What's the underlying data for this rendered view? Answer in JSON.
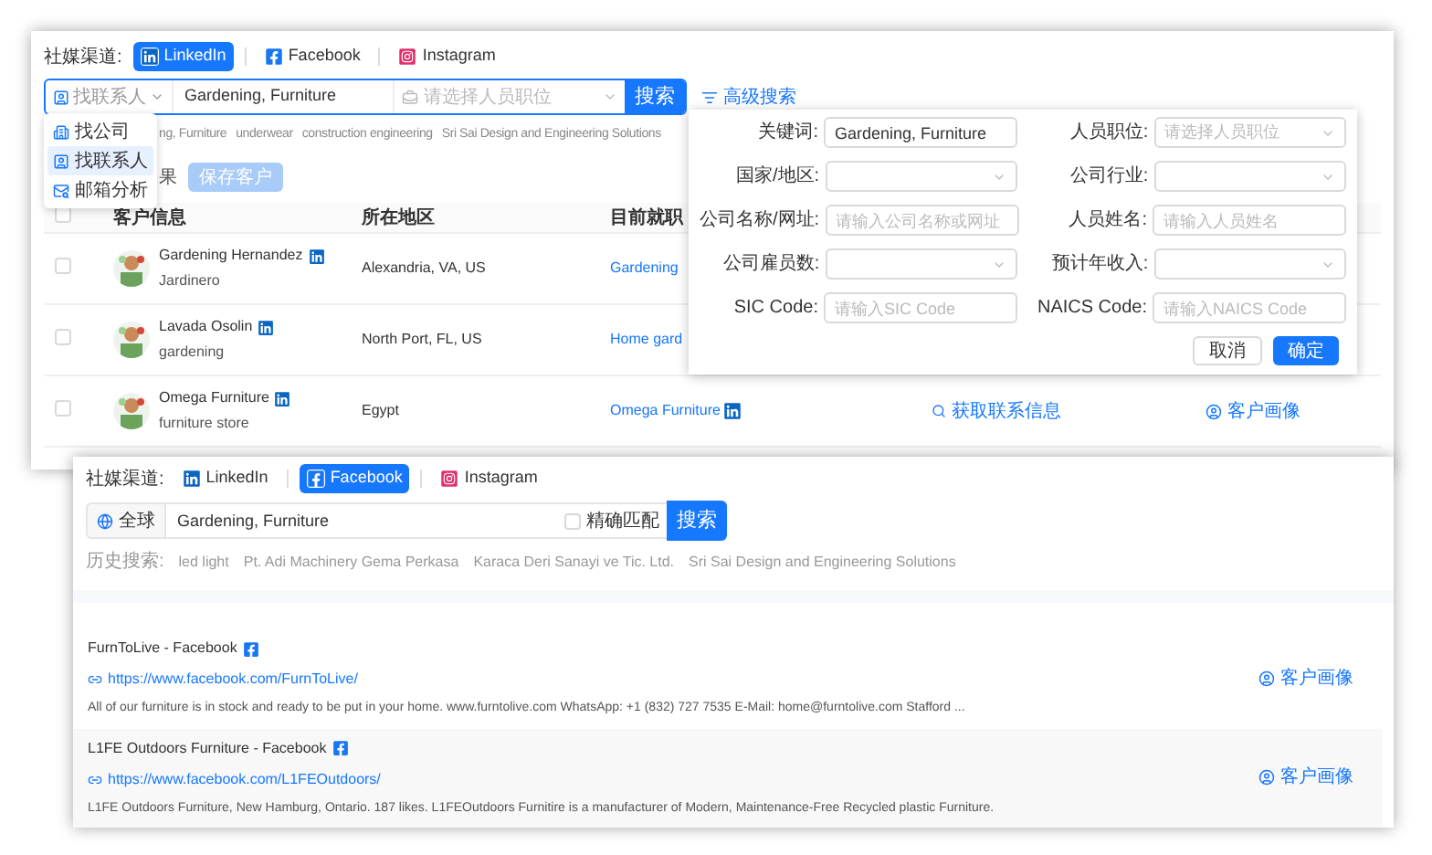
{
  "back_window": {
    "channel_label": "社媒渠道:",
    "channels": [
      {
        "name": "LinkedIn",
        "kind": "linkedin",
        "selected": true
      },
      {
        "name": "Facebook",
        "kind": "facebook",
        "selected": false
      },
      {
        "name": "Instagram",
        "kind": "instagram",
        "selected": false
      }
    ],
    "search": {
      "mode": "找联系人",
      "value": "Gardening, Furniture",
      "position_placeholder": "请选择人员职位",
      "button": "搜索"
    },
    "advanced_search": "高级搜索",
    "mode_menu": [
      {
        "label": "找公司",
        "kind": "company",
        "selected": false
      },
      {
        "label": "找联系人",
        "kind": "contact",
        "selected": true
      },
      {
        "label": "邮箱分析",
        "kind": "email",
        "selected": false
      }
    ],
    "history": [
      "ng, Furniture",
      "underwear",
      "construction engineering",
      "Sri Sai Design and Engineering Solutions"
    ],
    "result_label": "果",
    "save_button": {
      "label": "保存客户",
      "disabled": true
    },
    "table": {
      "checked": false,
      "columns": [
        "客户信息",
        "所在地区",
        "目前就职"
      ],
      "rows": [
        {
          "checked": false,
          "name": "Gardening Hernandez",
          "title": "Jardinero",
          "location": "Alexandria, VA, US",
          "company": "Gardening",
          "kind": "plain"
        },
        {
          "checked": false,
          "name": "Lavada Osolin",
          "title": "gardening",
          "location": "North Port, FL, US",
          "company": "Home gard",
          "kind": "plain"
        },
        {
          "checked": false,
          "name": "Omega Furniture",
          "title": "furniture store",
          "location": "Egypt",
          "company": "Omega Furniture",
          "kind": "badged",
          "contact_action": "获取联系信息",
          "profile_action": "客户画像"
        }
      ]
    }
  },
  "advanced_popover": {
    "fields": [
      {
        "label": "关键词:",
        "kind": "input",
        "value": "Gardening, Furniture"
      },
      {
        "label": "人员职位:",
        "kind": "select",
        "placeholder": "请选择人员职位"
      },
      {
        "label": "国家/地区:",
        "kind": "select"
      },
      {
        "label": "公司行业:",
        "kind": "select"
      },
      {
        "label": "公司名称/网址:",
        "kind": "input",
        "placeholder": "请输入公司名称或网址"
      },
      {
        "label": "人员姓名:",
        "kind": "input",
        "placeholder": "请输入人员姓名"
      },
      {
        "label": "公司雇员数:",
        "kind": "select"
      },
      {
        "label": "预计年收入:",
        "kind": "select"
      },
      {
        "label": "SIC Code:",
        "kind": "input",
        "placeholder": "请输入SIC Code"
      },
      {
        "label": "NAICS Code:",
        "kind": "input",
        "placeholder": "请输入NAICS Code"
      }
    ],
    "cancel": "取消",
    "confirm": "确定"
  },
  "front_window": {
    "channel_label": "社媒渠道:",
    "channels": [
      {
        "name": "LinkedIn",
        "kind": "linkedin",
        "selected": false
      },
      {
        "name": "Facebook",
        "kind": "facebook",
        "selected": true
      },
      {
        "name": "Instagram",
        "kind": "instagram",
        "selected": false
      }
    ],
    "search": {
      "scope": "全球",
      "value": "Gardening, Furniture",
      "exact_match": {
        "label": "精确匹配",
        "checked": false
      },
      "button": "搜索"
    },
    "history_label": "历史搜索:",
    "history": [
      "led light",
      "Pt. Adi Machinery Gema Perkasa",
      "Karaca Deri Sanayi ve Tic. Ltd.",
      "Sri Sai Design and Engineering Solutions"
    ],
    "results": [
      {
        "title": "FurnToLive - Facebook",
        "url": "https://www.facebook.com/FurnToLive/",
        "description": "All of our furniture is in stock and ready to be put in your home. www.furntolive.com WhatsApp: +1 (832) 727 7535 E-Mail: home@furntolive.com Stafford ...",
        "action": "客户画像"
      },
      {
        "title": "L1FE Outdoors Furniture - Facebook",
        "url": "https://www.facebook.com/L1FEOutdoors/",
        "description": "L1FE Outdoors Furniture, New Hamburg, Ontario. 187 likes. L1FEOutdoors Furnitire is a manufacturer of Modern, Maintenance-Free Recycled plastic Furniture.",
        "action": "客户画像"
      }
    ]
  }
}
